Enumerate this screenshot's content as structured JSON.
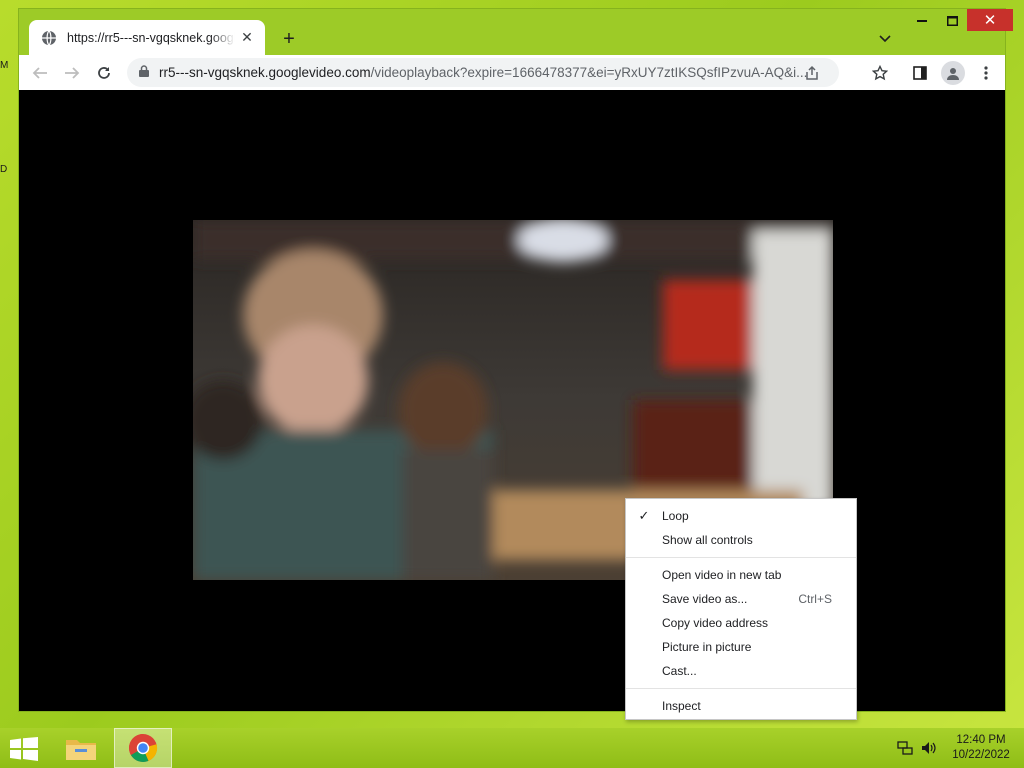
{
  "desktop": {
    "left_edge_labels": [
      "M",
      "D"
    ]
  },
  "browser": {
    "tab": {
      "title": "https://rr5---sn-vgqsknek.google",
      "close_glyph": "✕",
      "icon": "globe-icon"
    },
    "new_tab_glyph": "+",
    "window_controls": {
      "minimize": "—",
      "maximize": "☐",
      "close": "✕"
    },
    "toolbar": {
      "url_host": "rr5---sn-vgqsknek.googlevideo.com",
      "url_path": "/videoplayback?expire=1666478377&ei=yRxUY7ztIKSQsfIPzvuA-AQ&i...",
      "icons": [
        "back-arrow-icon",
        "forward-arrow-icon",
        "reload-icon",
        "lock-icon",
        "share-icon",
        "bookmark-star-icon",
        "side-panel-icon",
        "profile-icon",
        "kebab-menu-icon"
      ]
    }
  },
  "context_menu": {
    "groups": [
      [
        {
          "label": "Loop",
          "checked": true,
          "shortcut": ""
        },
        {
          "label": "Show all controls",
          "checked": false,
          "shortcut": ""
        }
      ],
      [
        {
          "label": "Open video in new tab",
          "checked": false,
          "shortcut": ""
        },
        {
          "label": "Save video as...",
          "checked": false,
          "shortcut": "Ctrl+S"
        },
        {
          "label": "Copy video address",
          "checked": false,
          "shortcut": ""
        },
        {
          "label": "Picture in picture",
          "checked": false,
          "shortcut": ""
        },
        {
          "label": "Cast...",
          "checked": false,
          "shortcut": ""
        }
      ],
      [
        {
          "label": "Inspect",
          "checked": false,
          "shortcut": ""
        }
      ]
    ],
    "check_glyph": "✓"
  },
  "taskbar": {
    "apps": [
      "file-explorer-icon",
      "chrome-icon"
    ],
    "clock": {
      "time": "12:40 PM",
      "date": "10/22/2022"
    }
  },
  "colors": {
    "desktop_green": "#9dcb27",
    "window_close_red": "#c7312b",
    "video_background": "#000000"
  }
}
